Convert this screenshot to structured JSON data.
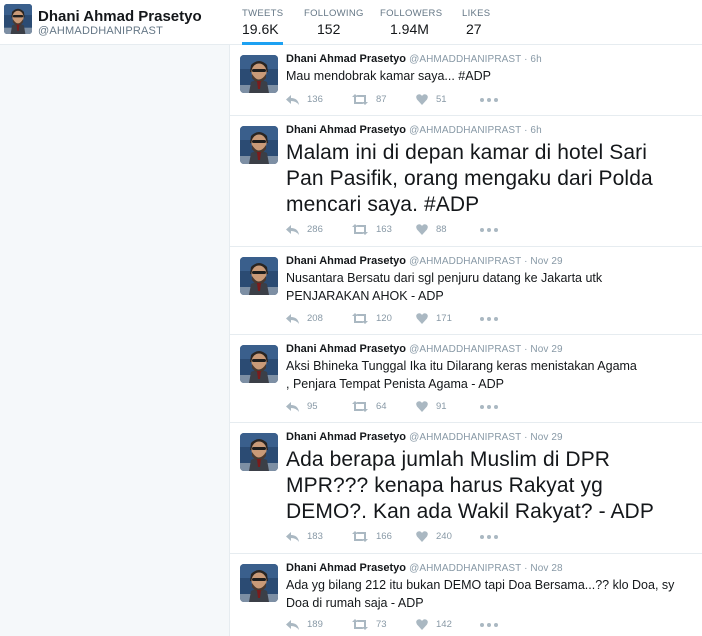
{
  "profile": {
    "name": "Dhani Ahmad Prasetyo",
    "handle": "@AHMADDHANIPRAST"
  },
  "stats": [
    {
      "label": "TWEETS",
      "value": "19.6K"
    },
    {
      "label": "FOLLOWING",
      "value": "152"
    },
    {
      "label": "FOLLOWERS",
      "value": "1.94M"
    },
    {
      "label": "LIKES",
      "value": "27"
    }
  ],
  "tweets": [
    {
      "name": "Dhani Ahmad Prasetyo",
      "meta": "@AHMADDHANIPRAST · 6h",
      "text": "Mau mendobrak kamar saya... #ADP",
      "replies": "136",
      "retweets": "87",
      "likes": "51"
    },
    {
      "name": "Dhani Ahmad Prasetyo",
      "meta": "@AHMADDHANIPRAST · 6h",
      "text": "Malam ini di depan kamar di hotel Sari Pan Pasifik, orang mengaku dari Polda mencari saya. #ADP",
      "replies": "286",
      "retweets": "163",
      "likes": "88"
    },
    {
      "name": "Dhani Ahmad Prasetyo",
      "meta": "@AHMADDHANIPRAST · Nov 29",
      "text": "Nusantara Bersatu dari sgl penjuru datang ke Jakarta utk PENJARAKAN AHOK - ADP",
      "replies": "208",
      "retweets": "120",
      "likes": "171"
    },
    {
      "name": "Dhani Ahmad Prasetyo",
      "meta": "@AHMADDHANIPRAST · Nov 29",
      "text": "Aksi Bhineka Tunggal Ika itu Dilarang keras menistakan Agama , Penjara Tempat Penista Agama - ADP",
      "replies": "95",
      "retweets": "64",
      "likes": "91"
    },
    {
      "name": "Dhani Ahmad Prasetyo",
      "meta": "@AHMADDHANIPRAST · Nov 29",
      "text": "Ada berapa jumlah Muslim di DPR MPR??? kenapa harus Rakyat yg DEMO?. Kan ada Wakil Rakyat? - ADP",
      "replies": "183",
      "retweets": "166",
      "likes": "240"
    },
    {
      "name": "Dhani Ahmad Prasetyo",
      "meta": "@AHMADDHANIPRAST · Nov 28",
      "text": "Ada yg bilang 212 itu bukan DEMO tapi Doa Bersama...?? klo Doa, sy Doa di rumah saja - ADP",
      "replies": "189",
      "retweets": "73",
      "likes": "142"
    }
  ],
  "colors": {
    "accent": "#1da1f2",
    "muted": "#8899a6",
    "border": "#e6ecf0",
    "sidebar": "#f5f8fa"
  }
}
